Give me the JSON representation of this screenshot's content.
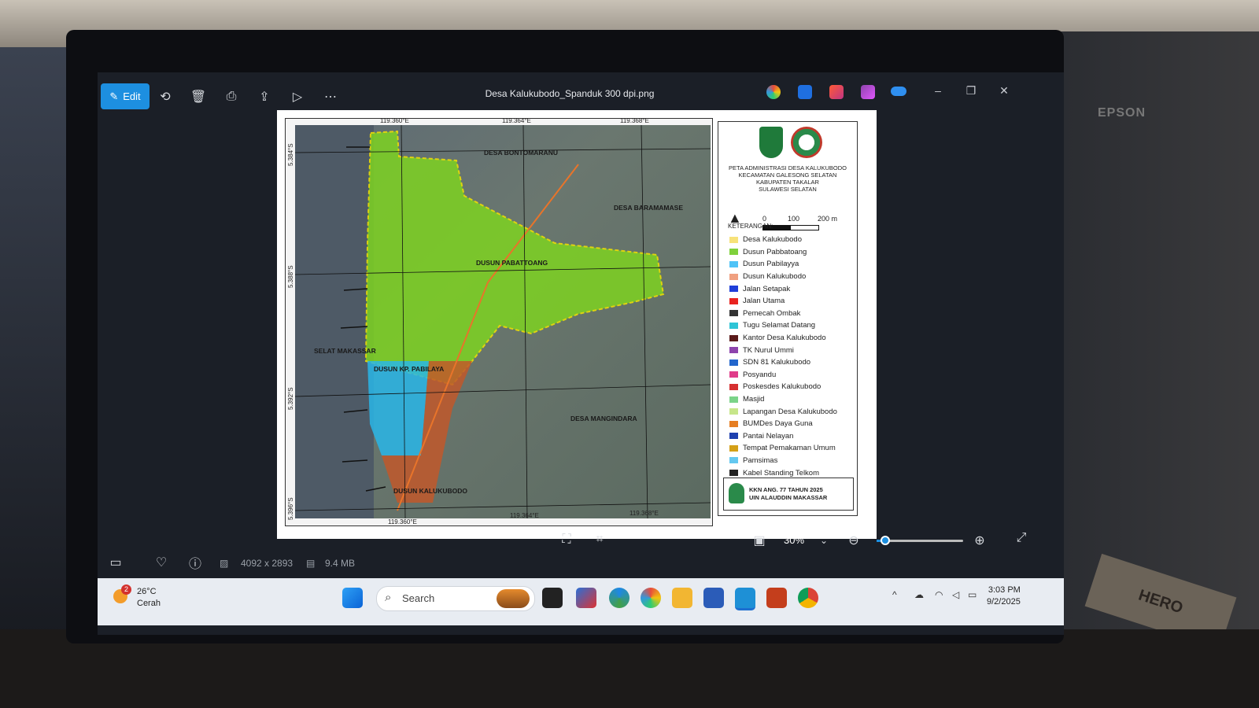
{
  "window": {
    "title": "Desa Kalukubodo_Spanduk 300 dpi.png",
    "edit_label": "Edit"
  },
  "map": {
    "lon_ticks": [
      "119.360°E",
      "119.364°E",
      "119.368°E"
    ],
    "lat_ticks": [
      "5.384°S",
      "5.388°S",
      "5.392°S",
      "5.396°S"
    ],
    "labels": {
      "bontomaranu": "DESA\nBONTOMARANU",
      "baramamase": "DESA\nBARAMAMASE",
      "pabattoang": "DUSUN\nPABATTOANG",
      "selat": "SELAT\nMAKASSAR",
      "pabilaya": "DUSUN\nKP. PABILAYA",
      "mangindara": "DESA\nMANGINDARA",
      "kalukubodo": "DUSUN\nKALUKUBODO"
    },
    "legend_title": "PETA ADMINISTRASI DESA KALUKUBODO\nKECAMATAN GALESONG SELATAN\nKABUPATEN TAKALAR\nSULAWESI SELATAN",
    "scale": {
      "s0": "0",
      "s1": "100",
      "s2": "200 m"
    },
    "keterangan": "KETERANGAN:",
    "legend_items": [
      {
        "label": "Desa Kalukubodo",
        "color": "#f7e27a"
      },
      {
        "label": "Dusun Pabbatoang",
        "color": "#7fd13b"
      },
      {
        "label": "Dusun Pabilayya",
        "color": "#4fc3f7"
      },
      {
        "label": "Dusun Kalukubodo",
        "color": "#f0a080"
      },
      {
        "label": "Jalan Setapak",
        "color": "#1f3fd9"
      },
      {
        "label": "Jalan Utama",
        "color": "#e8231f"
      },
      {
        "label": "Pemecah Ombak",
        "color": "#333333"
      },
      {
        "label": "Tugu Selamat Datang",
        "color": "#2ec4d6"
      },
      {
        "label": "Kantor Desa Kalukubodo",
        "color": "#5a1a1a"
      },
      {
        "label": "TK Nurul Ummi",
        "color": "#8e44ad"
      },
      {
        "label": "SDN 81 Kalukubodo",
        "color": "#2266cc"
      },
      {
        "label": "Posyandu",
        "color": "#e03c8a"
      },
      {
        "label": "Poskesdes Kalukubodo",
        "color": "#d63031"
      },
      {
        "label": "Masjid",
        "color": "#7bd389"
      },
      {
        "label": "Lapangan Desa Kalukubodo",
        "color": "#c7e68a"
      },
      {
        "label": "BUMDes Daya Guna",
        "color": "#e67e22"
      },
      {
        "label": "Pantai Nelayan",
        "color": "#1e40af"
      },
      {
        "label": "Tempat Pemakaman Umum",
        "color": "#d4a017"
      },
      {
        "label": "Pamsimas",
        "color": "#64c8f0"
      },
      {
        "label": "Kabel Standing Telkom",
        "color": "#222222"
      }
    ],
    "footer": "KKN ANG. 77 TAHUN 2025\nUIN ALAUDDIN MAKASSAR"
  },
  "zoom": {
    "level": "30%",
    "fraction": 0.1
  },
  "info": {
    "dimensions": "4092 x 2893",
    "size": "9.4 MB"
  },
  "taskbar": {
    "temp": "26°C",
    "weather": "Cerah",
    "weather_badge": "2",
    "search_placeholder": "Search",
    "time": "3:03 PM",
    "date": "9/2/2025"
  }
}
